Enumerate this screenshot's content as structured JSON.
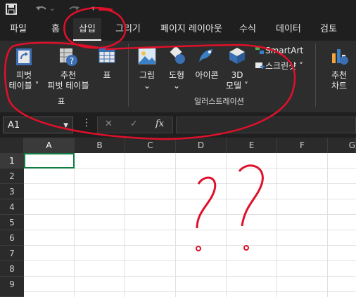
{
  "qat": {
    "save": "save-icon",
    "undo": "undo-icon",
    "redo": "redo-icon",
    "customize": "customize-icon"
  },
  "tabs": [
    "파일",
    "홈",
    "삽입",
    "그리기",
    "페이지 레이아웃",
    "수식",
    "데이터",
    "검토"
  ],
  "ribbon": {
    "tables": {
      "pivot_label_1": "피벗",
      "pivot_label_2": "테이블 ˅",
      "recommended_pivot_1": "추천",
      "recommended_pivot_2": "피벗 테이블",
      "table_label": "표",
      "group_label": "표"
    },
    "illustrations": {
      "pictures": "그림",
      "shapes": "도형",
      "icons": "아이콘",
      "models_1": "3D",
      "models_2": "모델 ˅",
      "smartart": "SmartArt",
      "screenshot": "스크린샷 ˅",
      "group_label": "일러스트레이션"
    },
    "charts": {
      "recommended_1": "추천",
      "recommended_2": "차트"
    }
  },
  "formula_bar": {
    "name_box": "A1",
    "cancel": "✕",
    "enter": "✓",
    "fx": "fx",
    "formula": ""
  },
  "columns": [
    "A",
    "B",
    "C",
    "D",
    "E",
    "F",
    "G"
  ],
  "rows": [
    "1",
    "2",
    "3",
    "4",
    "5",
    "6",
    "7",
    "8",
    "9"
  ],
  "annotation_marks": "??",
  "colors": {
    "dark": "#1f1f1f",
    "ribbon": "#2d2d2d",
    "select": "#107c41",
    "ink": "#e0102a"
  }
}
